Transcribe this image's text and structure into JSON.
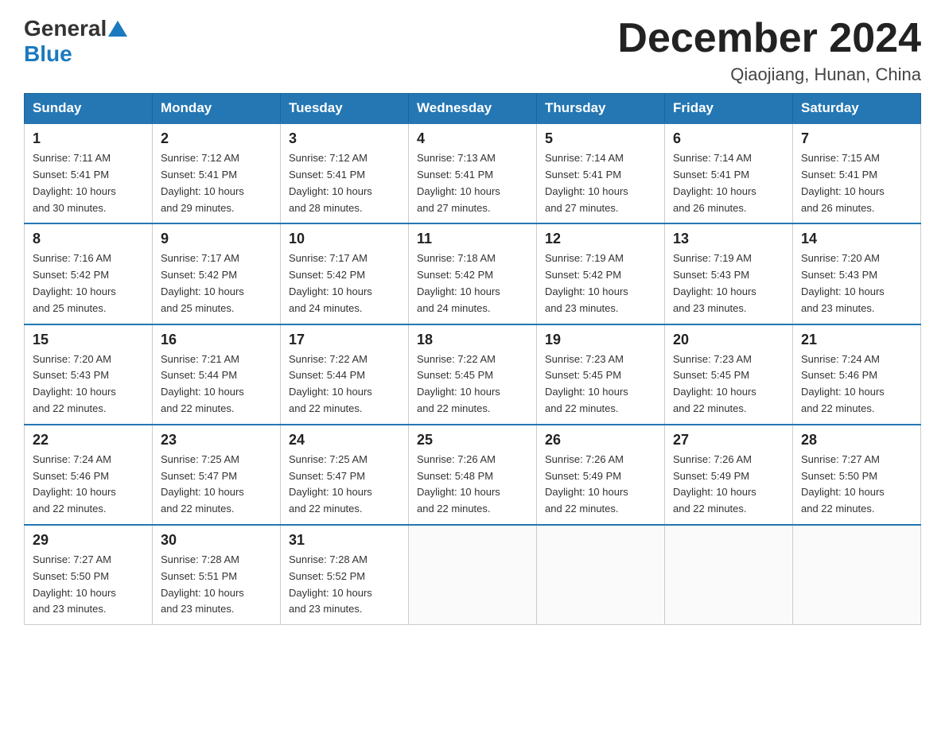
{
  "logo": {
    "general": "General",
    "blue": "Blue"
  },
  "title": "December 2024",
  "location": "Qiaojiang, Hunan, China",
  "weekdays": [
    "Sunday",
    "Monday",
    "Tuesday",
    "Wednesday",
    "Thursday",
    "Friday",
    "Saturday"
  ],
  "weeks": [
    [
      {
        "day": "1",
        "sunrise": "7:11 AM",
        "sunset": "5:41 PM",
        "daylight": "10 hours and 30 minutes."
      },
      {
        "day": "2",
        "sunrise": "7:12 AM",
        "sunset": "5:41 PM",
        "daylight": "10 hours and 29 minutes."
      },
      {
        "day": "3",
        "sunrise": "7:12 AM",
        "sunset": "5:41 PM",
        "daylight": "10 hours and 28 minutes."
      },
      {
        "day": "4",
        "sunrise": "7:13 AM",
        "sunset": "5:41 PM",
        "daylight": "10 hours and 27 minutes."
      },
      {
        "day": "5",
        "sunrise": "7:14 AM",
        "sunset": "5:41 PM",
        "daylight": "10 hours and 27 minutes."
      },
      {
        "day": "6",
        "sunrise": "7:14 AM",
        "sunset": "5:41 PM",
        "daylight": "10 hours and 26 minutes."
      },
      {
        "day": "7",
        "sunrise": "7:15 AM",
        "sunset": "5:41 PM",
        "daylight": "10 hours and 26 minutes."
      }
    ],
    [
      {
        "day": "8",
        "sunrise": "7:16 AM",
        "sunset": "5:42 PM",
        "daylight": "10 hours and 25 minutes."
      },
      {
        "day": "9",
        "sunrise": "7:17 AM",
        "sunset": "5:42 PM",
        "daylight": "10 hours and 25 minutes."
      },
      {
        "day": "10",
        "sunrise": "7:17 AM",
        "sunset": "5:42 PM",
        "daylight": "10 hours and 24 minutes."
      },
      {
        "day": "11",
        "sunrise": "7:18 AM",
        "sunset": "5:42 PM",
        "daylight": "10 hours and 24 minutes."
      },
      {
        "day": "12",
        "sunrise": "7:19 AM",
        "sunset": "5:42 PM",
        "daylight": "10 hours and 23 minutes."
      },
      {
        "day": "13",
        "sunrise": "7:19 AM",
        "sunset": "5:43 PM",
        "daylight": "10 hours and 23 minutes."
      },
      {
        "day": "14",
        "sunrise": "7:20 AM",
        "sunset": "5:43 PM",
        "daylight": "10 hours and 23 minutes."
      }
    ],
    [
      {
        "day": "15",
        "sunrise": "7:20 AM",
        "sunset": "5:43 PM",
        "daylight": "10 hours and 22 minutes."
      },
      {
        "day": "16",
        "sunrise": "7:21 AM",
        "sunset": "5:44 PM",
        "daylight": "10 hours and 22 minutes."
      },
      {
        "day": "17",
        "sunrise": "7:22 AM",
        "sunset": "5:44 PM",
        "daylight": "10 hours and 22 minutes."
      },
      {
        "day": "18",
        "sunrise": "7:22 AM",
        "sunset": "5:45 PM",
        "daylight": "10 hours and 22 minutes."
      },
      {
        "day": "19",
        "sunrise": "7:23 AM",
        "sunset": "5:45 PM",
        "daylight": "10 hours and 22 minutes."
      },
      {
        "day": "20",
        "sunrise": "7:23 AM",
        "sunset": "5:45 PM",
        "daylight": "10 hours and 22 minutes."
      },
      {
        "day": "21",
        "sunrise": "7:24 AM",
        "sunset": "5:46 PM",
        "daylight": "10 hours and 22 minutes."
      }
    ],
    [
      {
        "day": "22",
        "sunrise": "7:24 AM",
        "sunset": "5:46 PM",
        "daylight": "10 hours and 22 minutes."
      },
      {
        "day": "23",
        "sunrise": "7:25 AM",
        "sunset": "5:47 PM",
        "daylight": "10 hours and 22 minutes."
      },
      {
        "day": "24",
        "sunrise": "7:25 AM",
        "sunset": "5:47 PM",
        "daylight": "10 hours and 22 minutes."
      },
      {
        "day": "25",
        "sunrise": "7:26 AM",
        "sunset": "5:48 PM",
        "daylight": "10 hours and 22 minutes."
      },
      {
        "day": "26",
        "sunrise": "7:26 AM",
        "sunset": "5:49 PM",
        "daylight": "10 hours and 22 minutes."
      },
      {
        "day": "27",
        "sunrise": "7:26 AM",
        "sunset": "5:49 PM",
        "daylight": "10 hours and 22 minutes."
      },
      {
        "day": "28",
        "sunrise": "7:27 AM",
        "sunset": "5:50 PM",
        "daylight": "10 hours and 22 minutes."
      }
    ],
    [
      {
        "day": "29",
        "sunrise": "7:27 AM",
        "sunset": "5:50 PM",
        "daylight": "10 hours and 23 minutes."
      },
      {
        "day": "30",
        "sunrise": "7:28 AM",
        "sunset": "5:51 PM",
        "daylight": "10 hours and 23 minutes."
      },
      {
        "day": "31",
        "sunrise": "7:28 AM",
        "sunset": "5:52 PM",
        "daylight": "10 hours and 23 minutes."
      },
      null,
      null,
      null,
      null
    ]
  ],
  "labels": {
    "sunrise": "Sunrise:",
    "sunset": "Sunset:",
    "daylight": "Daylight:"
  }
}
